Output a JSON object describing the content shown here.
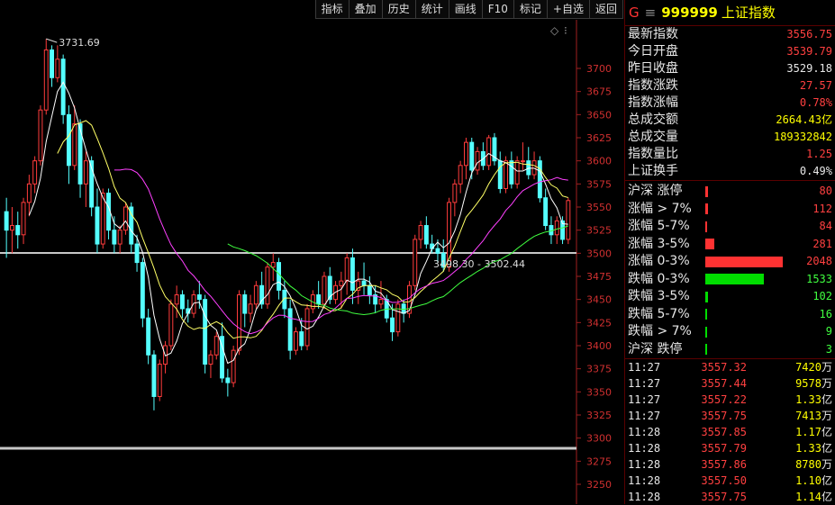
{
  "toolbar": {
    "items": [
      "指标",
      "叠加",
      "历史",
      "统计",
      "画线",
      "F10",
      "标记",
      "+自选",
      "返回"
    ]
  },
  "chart": {
    "high_label": "3731.69",
    "range_label": "3498.30 - 3502.44",
    "y_ticks": [
      "3700",
      "3675",
      "3650",
      "3625",
      "3600",
      "3575",
      "3550",
      "3525",
      "3500",
      "3475",
      "3450",
      "3425",
      "3400",
      "3375",
      "3350",
      "3325",
      "3300",
      "3275",
      "3250"
    ],
    "colors": {
      "up": "#ff3c3c",
      "down": "#54ffff",
      "ma_white": "#ffffff",
      "ma_yellow": "#ffff66",
      "ma_magenta": "#ff40ff",
      "ma_green": "#40ff40"
    }
  },
  "header": {
    "prefix": "G",
    "menu_glyph": "≡",
    "code": "999999",
    "name": "上证指数"
  },
  "stats": [
    {
      "label": "最新指数",
      "value": "3556.75",
      "color": "#ff4040"
    },
    {
      "label": "今日开盘",
      "value": "3539.79",
      "color": "#ff4040"
    },
    {
      "label": "昨日收盘",
      "value": "3529.18",
      "color": "#e8e8e8"
    },
    {
      "label": "指数涨跌",
      "value": "27.57",
      "color": "#ff4040"
    },
    {
      "label": "指数涨幅",
      "value": "0.78%",
      "color": "#ff4040"
    },
    {
      "label": "总成交额",
      "value": "2664.43亿",
      "color": "#ffff00"
    },
    {
      "label": "总成交量",
      "value": "189332842",
      "color": "#ffff00"
    },
    {
      "label": "指数量比",
      "value": "1.25",
      "color": "#ff4040"
    },
    {
      "label": "上证换手",
      "value": "0.49%",
      "color": "#e8e8e8"
    }
  ],
  "breadth": [
    {
      "label": "沪深 涨停",
      "count": "80",
      "count_color": "#ff4040",
      "bar_color": "#ff3232",
      "fraction": 0.03
    },
    {
      "label": "涨幅 > 7%",
      "count": "112",
      "count_color": "#ff4040",
      "bar_color": "#ff3232",
      "fraction": 0.035
    },
    {
      "label": "涨幅 5-7%",
      "count": "84",
      "count_color": "#ff4040",
      "bar_color": "#ff3232",
      "fraction": 0.025
    },
    {
      "label": "涨幅 3-5%",
      "count": "281",
      "count_color": "#ff4040",
      "bar_color": "#ff3232",
      "fraction": 0.12
    },
    {
      "label": "涨幅 0-3%",
      "count": "2048",
      "count_color": "#ff4040",
      "bar_color": "#ff3232",
      "fraction": 1.0
    },
    {
      "label": "跌幅 0-3%",
      "count": "1533",
      "count_color": "#40ff40",
      "bar_color": "#00dd00",
      "fraction": 0.75
    },
    {
      "label": "跌幅 3-5%",
      "count": "102",
      "count_color": "#40ff40",
      "bar_color": "#00dd00",
      "fraction": 0.04
    },
    {
      "label": "跌幅 5-7%",
      "count": "16",
      "count_color": "#40ff40",
      "bar_color": "#00dd00",
      "fraction": 0.008
    },
    {
      "label": "跌幅 > 7%",
      "count": "9",
      "count_color": "#40ff40",
      "bar_color": "#00dd00",
      "fraction": 0.006
    },
    {
      "label": "沪深 跌停",
      "count": "3",
      "count_color": "#40ff40",
      "bar_color": "#00dd00",
      "fraction": 0.004
    }
  ],
  "ticks": [
    {
      "time": "11:27",
      "price": "3557.32",
      "vol": "7420",
      "unit": "万"
    },
    {
      "time": "11:27",
      "price": "3557.44",
      "vol": "9578",
      "unit": "万"
    },
    {
      "time": "11:27",
      "price": "3557.22",
      "vol": "1.33",
      "unit": "亿"
    },
    {
      "time": "11:27",
      "price": "3557.75",
      "vol": "7413",
      "unit": "万"
    },
    {
      "time": "11:28",
      "price": "3557.85",
      "vol": "1.17",
      "unit": "亿"
    },
    {
      "time": "11:28",
      "price": "3557.79",
      "vol": "1.33",
      "unit": "亿"
    },
    {
      "time": "11:28",
      "price": "3557.86",
      "vol": "8780",
      "unit": "万"
    },
    {
      "time": "11:28",
      "price": "3557.50",
      "vol": "1.10",
      "unit": "亿"
    },
    {
      "time": "11:28",
      "price": "3557.75",
      "vol": "1.14",
      "unit": "亿"
    }
  ],
  "chart_data": {
    "type": "candlestick",
    "title": "",
    "ylim": [
      3245,
      3745
    ],
    "annotations": [
      "3731.69",
      "3498.30 - 3502.44"
    ],
    "candles": [
      {
        "o": 3545,
        "h": 3560,
        "l": 3495,
        "c": 3525
      },
      {
        "o": 3525,
        "h": 3550,
        "l": 3500,
        "c": 3530
      },
      {
        "o": 3530,
        "h": 3545,
        "l": 3505,
        "c": 3520
      },
      {
        "o": 3520,
        "h": 3560,
        "l": 3510,
        "c": 3555
      },
      {
        "o": 3555,
        "h": 3585,
        "l": 3540,
        "c": 3575
      },
      {
        "o": 3575,
        "h": 3605,
        "l": 3565,
        "c": 3600
      },
      {
        "o": 3600,
        "h": 3660,
        "l": 3595,
        "c": 3655
      },
      {
        "o": 3655,
        "h": 3732,
        "l": 3650,
        "c": 3720
      },
      {
        "o": 3720,
        "h": 3725,
        "l": 3680,
        "c": 3690
      },
      {
        "o": 3690,
        "h": 3725,
        "l": 3685,
        "c": 3710
      },
      {
        "o": 3710,
        "h": 3715,
        "l": 3640,
        "c": 3650
      },
      {
        "o": 3650,
        "h": 3660,
        "l": 3575,
        "c": 3595
      },
      {
        "o": 3595,
        "h": 3660,
        "l": 3590,
        "c": 3640
      },
      {
        "o": 3640,
        "h": 3645,
        "l": 3560,
        "c": 3575
      },
      {
        "o": 3575,
        "h": 3610,
        "l": 3550,
        "c": 3600
      },
      {
        "o": 3600,
        "h": 3605,
        "l": 3540,
        "c": 3550
      },
      {
        "o": 3550,
        "h": 3570,
        "l": 3500,
        "c": 3510
      },
      {
        "o": 3510,
        "h": 3570,
        "l": 3505,
        "c": 3565
      },
      {
        "o": 3565,
        "h": 3570,
        "l": 3515,
        "c": 3525
      },
      {
        "o": 3525,
        "h": 3540,
        "l": 3500,
        "c": 3510
      },
      {
        "o": 3510,
        "h": 3530,
        "l": 3500,
        "c": 3525
      },
      {
        "o": 3525,
        "h": 3555,
        "l": 3520,
        "c": 3550
      },
      {
        "o": 3550,
        "h": 3555,
        "l": 3500,
        "c": 3510
      },
      {
        "o": 3510,
        "h": 3520,
        "l": 3480,
        "c": 3490
      },
      {
        "o": 3490,
        "h": 3495,
        "l": 3420,
        "c": 3430
      },
      {
        "o": 3430,
        "h": 3440,
        "l": 3380,
        "c": 3390
      },
      {
        "o": 3390,
        "h": 3395,
        "l": 3330,
        "c": 3345
      },
      {
        "o": 3345,
        "h": 3385,
        "l": 3340,
        "c": 3380
      },
      {
        "o": 3380,
        "h": 3405,
        "l": 3370,
        "c": 3400
      },
      {
        "o": 3400,
        "h": 3450,
        "l": 3395,
        "c": 3445
      },
      {
        "o": 3445,
        "h": 3465,
        "l": 3430,
        "c": 3455
      },
      {
        "o": 3455,
        "h": 3460,
        "l": 3430,
        "c": 3440
      },
      {
        "o": 3440,
        "h": 3450,
        "l": 3425,
        "c": 3435
      },
      {
        "o": 3435,
        "h": 3460,
        "l": 3430,
        "c": 3455
      },
      {
        "o": 3455,
        "h": 3470,
        "l": 3440,
        "c": 3450
      },
      {
        "o": 3450,
        "h": 3455,
        "l": 3370,
        "c": 3380
      },
      {
        "o": 3380,
        "h": 3395,
        "l": 3365,
        "c": 3390
      },
      {
        "o": 3390,
        "h": 3415,
        "l": 3385,
        "c": 3410
      },
      {
        "o": 3410,
        "h": 3425,
        "l": 3360,
        "c": 3365
      },
      {
        "o": 3365,
        "h": 3375,
        "l": 3345,
        "c": 3360
      },
      {
        "o": 3360,
        "h": 3400,
        "l": 3355,
        "c": 3395
      },
      {
        "o": 3395,
        "h": 3460,
        "l": 3390,
        "c": 3455
      },
      {
        "o": 3455,
        "h": 3460,
        "l": 3420,
        "c": 3435
      },
      {
        "o": 3435,
        "h": 3455,
        "l": 3425,
        "c": 3445
      },
      {
        "o": 3445,
        "h": 3470,
        "l": 3440,
        "c": 3465
      },
      {
        "o": 3465,
        "h": 3480,
        "l": 3440,
        "c": 3445
      },
      {
        "o": 3445,
        "h": 3490,
        "l": 3440,
        "c": 3485
      },
      {
        "o": 3485,
        "h": 3500,
        "l": 3470,
        "c": 3490
      },
      {
        "o": 3490,
        "h": 3495,
        "l": 3450,
        "c": 3460
      },
      {
        "o": 3460,
        "h": 3470,
        "l": 3430,
        "c": 3440
      },
      {
        "o": 3440,
        "h": 3450,
        "l": 3385,
        "c": 3395
      },
      {
        "o": 3395,
        "h": 3420,
        "l": 3390,
        "c": 3415
      },
      {
        "o": 3415,
        "h": 3430,
        "l": 3395,
        "c": 3400
      },
      {
        "o": 3400,
        "h": 3445,
        "l": 3395,
        "c": 3440
      },
      {
        "o": 3440,
        "h": 3460,
        "l": 3435,
        "c": 3455
      },
      {
        "o": 3455,
        "h": 3470,
        "l": 3440,
        "c": 3445
      },
      {
        "o": 3445,
        "h": 3480,
        "l": 3440,
        "c": 3475
      },
      {
        "o": 3475,
        "h": 3485,
        "l": 3445,
        "c": 3450
      },
      {
        "o": 3450,
        "h": 3470,
        "l": 3445,
        "c": 3465
      },
      {
        "o": 3465,
        "h": 3480,
        "l": 3440,
        "c": 3470
      },
      {
        "o": 3470,
        "h": 3500,
        "l": 3455,
        "c": 3495
      },
      {
        "o": 3495,
        "h": 3505,
        "l": 3445,
        "c": 3460
      },
      {
        "o": 3460,
        "h": 3480,
        "l": 3445,
        "c": 3470
      },
      {
        "o": 3470,
        "h": 3490,
        "l": 3455,
        "c": 3465
      },
      {
        "o": 3465,
        "h": 3475,
        "l": 3445,
        "c": 3455
      },
      {
        "o": 3455,
        "h": 3465,
        "l": 3435,
        "c": 3445
      },
      {
        "o": 3445,
        "h": 3470,
        "l": 3440,
        "c": 3450
      },
      {
        "o": 3450,
        "h": 3455,
        "l": 3425,
        "c": 3430
      },
      {
        "o": 3430,
        "h": 3445,
        "l": 3405,
        "c": 3415
      },
      {
        "o": 3415,
        "h": 3450,
        "l": 3410,
        "c": 3445
      },
      {
        "o": 3445,
        "h": 3450,
        "l": 3425,
        "c": 3435
      },
      {
        "o": 3435,
        "h": 3470,
        "l": 3430,
        "c": 3465
      },
      {
        "o": 3465,
        "h": 3520,
        "l": 3460,
        "c": 3515
      },
      {
        "o": 3515,
        "h": 3535,
        "l": 3505,
        "c": 3530
      },
      {
        "o": 3530,
        "h": 3540,
        "l": 3505,
        "c": 3510
      },
      {
        "o": 3510,
        "h": 3520,
        "l": 3500,
        "c": 3505
      },
      {
        "o": 3505,
        "h": 3515,
        "l": 3490,
        "c": 3500
      },
      {
        "o": 3500,
        "h": 3515,
        "l": 3480,
        "c": 3485
      },
      {
        "o": 3485,
        "h": 3560,
        "l": 3480,
        "c": 3555
      },
      {
        "o": 3555,
        "h": 3580,
        "l": 3540,
        "c": 3575
      },
      {
        "o": 3575,
        "h": 3600,
        "l": 3565,
        "c": 3595
      },
      {
        "o": 3595,
        "h": 3625,
        "l": 3580,
        "c": 3620
      },
      {
        "o": 3620,
        "h": 3625,
        "l": 3580,
        "c": 3590
      },
      {
        "o": 3590,
        "h": 3615,
        "l": 3585,
        "c": 3610
      },
      {
        "o": 3610,
        "h": 3620,
        "l": 3590,
        "c": 3595
      },
      {
        "o": 3595,
        "h": 3628,
        "l": 3590,
        "c": 3625
      },
      {
        "o": 3625,
        "h": 3630,
        "l": 3595,
        "c": 3600
      },
      {
        "o": 3600,
        "h": 3610,
        "l": 3565,
        "c": 3570
      },
      {
        "o": 3570,
        "h": 3605,
        "l": 3565,
        "c": 3600
      },
      {
        "o": 3600,
        "h": 3610,
        "l": 3570,
        "c": 3575
      },
      {
        "o": 3575,
        "h": 3605,
        "l": 3570,
        "c": 3600
      },
      {
        "o": 3600,
        "h": 3620,
        "l": 3590,
        "c": 3600
      },
      {
        "o": 3600,
        "h": 3615,
        "l": 3580,
        "c": 3585
      },
      {
        "o": 3585,
        "h": 3610,
        "l": 3580,
        "c": 3600
      },
      {
        "o": 3600,
        "h": 3605,
        "l": 3555,
        "c": 3560
      },
      {
        "o": 3560,
        "h": 3570,
        "l": 3525,
        "c": 3530
      },
      {
        "o": 3530,
        "h": 3540,
        "l": 3510,
        "c": 3520
      },
      {
        "o": 3520,
        "h": 3540,
        "l": 3510,
        "c": 3535
      },
      {
        "o": 3535,
        "h": 3540,
        "l": 3510,
        "c": 3515
      },
      {
        "o": 3515,
        "h": 3560,
        "l": 3510,
        "c": 3557
      }
    ]
  }
}
